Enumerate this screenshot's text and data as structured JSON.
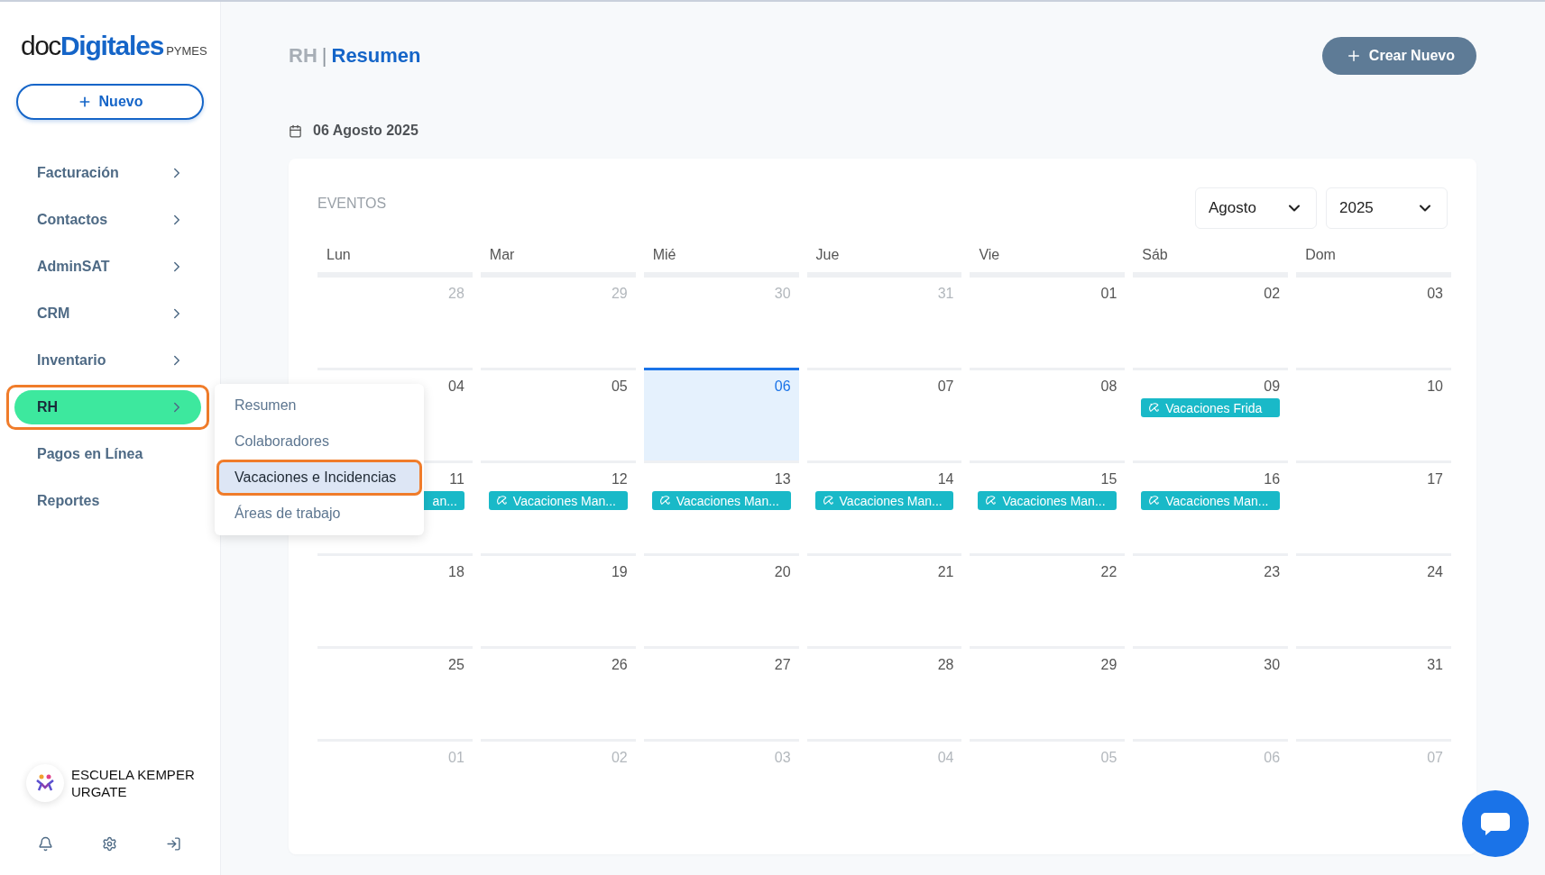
{
  "sidebar": {
    "logo": {
      "prefix": "doc",
      "name": "Digitales",
      "suffix": "PYMES"
    },
    "new_button": {
      "label": "Nuevo"
    },
    "items": [
      {
        "label": "Facturación",
        "has_children": true,
        "selected": false,
        "highlighted": false
      },
      {
        "label": "Contactos",
        "has_children": true,
        "selected": false,
        "highlighted": false
      },
      {
        "label": "AdminSAT",
        "has_children": true,
        "selected": false,
        "highlighted": false
      },
      {
        "label": "CRM",
        "has_children": true,
        "selected": false,
        "highlighted": false
      },
      {
        "label": "Inventario",
        "has_children": true,
        "selected": false,
        "highlighted": false
      },
      {
        "label": "RH",
        "has_children": true,
        "selected": true,
        "highlighted": true,
        "submenu": [
          {
            "label": "Resumen",
            "selected": false,
            "highlighted": false
          },
          {
            "label": "Colaboradores",
            "selected": false,
            "highlighted": false
          },
          {
            "label": "Vacaciones e Incidencias",
            "selected": true,
            "highlighted": true
          },
          {
            "label": "Áreas de trabajo",
            "selected": false,
            "highlighted": false
          }
        ]
      },
      {
        "label": "Pagos en Línea",
        "has_children": false,
        "selected": false,
        "highlighted": false
      },
      {
        "label": "Reportes",
        "has_children": false,
        "selected": false,
        "highlighted": false
      }
    ],
    "account": {
      "name": "ESCUELA KEMPER URGATE"
    }
  },
  "header": {
    "section": "RH",
    "separator": "|",
    "page": "Resumen",
    "create_button": "Crear Nuevo"
  },
  "date": "06 Agosto 2025",
  "calendar": {
    "title": "EVENTOS",
    "month": "Agosto",
    "year": "2025",
    "weekdays": [
      "Lun",
      "Mar",
      "Mié",
      "Jue",
      "Vie",
      "Sáb",
      "Dom"
    ],
    "weeks": [
      [
        {
          "day": "28",
          "outside": true,
          "today": false
        },
        {
          "day": "29",
          "outside": true,
          "today": false
        },
        {
          "day": "30",
          "outside": true,
          "today": false
        },
        {
          "day": "31",
          "outside": true,
          "today": false
        },
        {
          "day": "01",
          "outside": false,
          "today": false
        },
        {
          "day": "02",
          "outside": false,
          "today": false
        },
        {
          "day": "03",
          "outside": false,
          "today": false
        }
      ],
      [
        {
          "day": "04",
          "outside": false,
          "today": false
        },
        {
          "day": "05",
          "outside": false,
          "today": false
        },
        {
          "day": "06",
          "outside": false,
          "today": true
        },
        {
          "day": "07",
          "outside": false,
          "today": false
        },
        {
          "day": "08",
          "outside": false,
          "today": false
        },
        {
          "day": "09",
          "outside": false,
          "today": false,
          "events": [
            {
              "label": "Vacaciones Frida",
              "icon": true
            }
          ]
        },
        {
          "day": "10",
          "outside": false,
          "today": false
        }
      ],
      [
        {
          "day": "11",
          "outside": false,
          "today": false,
          "events": [
            {
              "label": "an...",
              "icon": false
            }
          ]
        },
        {
          "day": "12",
          "outside": false,
          "today": false,
          "events": [
            {
              "label": "Vacaciones Man...",
              "icon": true
            }
          ]
        },
        {
          "day": "13",
          "outside": false,
          "today": false,
          "events": [
            {
              "label": "Vacaciones Man...",
              "icon": true
            }
          ]
        },
        {
          "day": "14",
          "outside": false,
          "today": false,
          "events": [
            {
              "label": "Vacaciones Man...",
              "icon": true
            }
          ]
        },
        {
          "day": "15",
          "outside": false,
          "today": false,
          "events": [
            {
              "label": "Vacaciones Man...",
              "icon": true
            }
          ]
        },
        {
          "day": "16",
          "outside": false,
          "today": false,
          "events": [
            {
              "label": "Vacaciones Man...",
              "icon": true
            }
          ]
        },
        {
          "day": "17",
          "outside": false,
          "today": false
        }
      ],
      [
        {
          "day": "18",
          "outside": false,
          "today": false
        },
        {
          "day": "19",
          "outside": false,
          "today": false
        },
        {
          "day": "20",
          "outside": false,
          "today": false
        },
        {
          "day": "21",
          "outside": false,
          "today": false
        },
        {
          "day": "22",
          "outside": false,
          "today": false
        },
        {
          "day": "23",
          "outside": false,
          "today": false
        },
        {
          "day": "24",
          "outside": false,
          "today": false
        }
      ],
      [
        {
          "day": "25",
          "outside": false,
          "today": false
        },
        {
          "day": "26",
          "outside": false,
          "today": false
        },
        {
          "day": "27",
          "outside": false,
          "today": false
        },
        {
          "day": "28",
          "outside": false,
          "today": false
        },
        {
          "day": "29",
          "outside": false,
          "today": false
        },
        {
          "day": "30",
          "outside": false,
          "today": false
        },
        {
          "day": "31",
          "outside": false,
          "today": false
        }
      ],
      [
        {
          "day": "01",
          "outside": true,
          "today": false
        },
        {
          "day": "02",
          "outside": true,
          "today": false
        },
        {
          "day": "03",
          "outside": true,
          "today": false
        },
        {
          "day": "04",
          "outside": true,
          "today": false
        },
        {
          "day": "05",
          "outside": true,
          "today": false
        },
        {
          "day": "06",
          "outside": true,
          "today": false
        },
        {
          "day": "07",
          "outside": true,
          "today": false
        }
      ]
    ]
  }
}
